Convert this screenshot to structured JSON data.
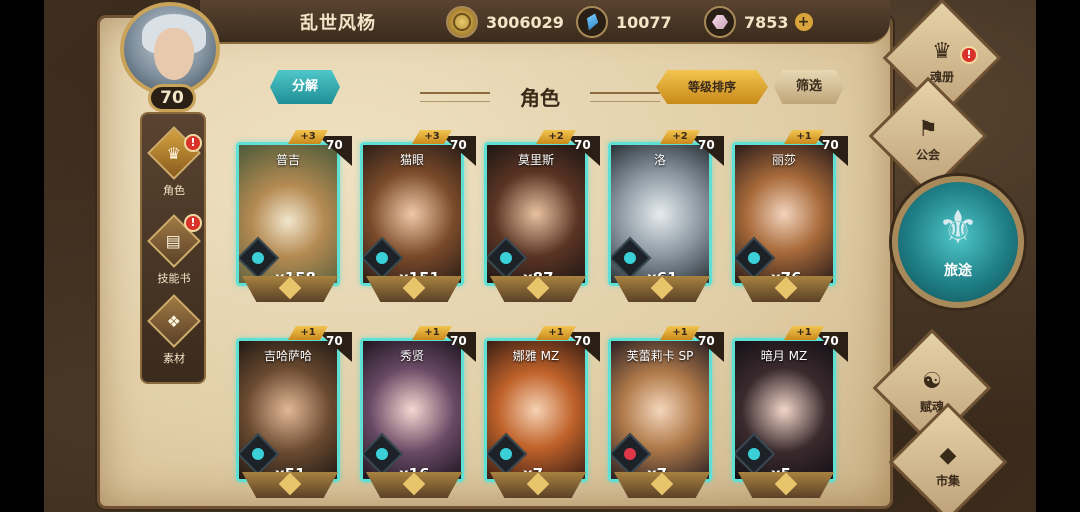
{
  "player": {
    "name": "乱世风杨",
    "level": "70"
  },
  "currencies": [
    {
      "icon": "gold-coin-icon",
      "value": "3006029"
    },
    {
      "icon": "blue-crystal-icon",
      "value": "10077"
    },
    {
      "icon": "pink-crystal-icon",
      "value": "7853"
    }
  ],
  "header": {
    "decompose": "分解",
    "title": "角色",
    "sort": "等级排序",
    "filter": "筛选"
  },
  "sidebar": {
    "items": [
      {
        "label": "角色",
        "active": true,
        "alert": "!"
      },
      {
        "label": "技能书",
        "active": false,
        "alert": "!"
      },
      {
        "label": "素材",
        "active": false,
        "alert": ""
      }
    ]
  },
  "cards": [
    {
      "name": "普吉",
      "level": "70",
      "plus": "+3",
      "count": "x158"
    },
    {
      "name": "猫眼",
      "level": "70",
      "plus": "+3",
      "count": "x151"
    },
    {
      "name": "莫里斯",
      "level": "70",
      "plus": "+2",
      "count": "x87"
    },
    {
      "name": "洛",
      "level": "70",
      "plus": "+2",
      "count": "x61"
    },
    {
      "name": "丽莎",
      "level": "70",
      "plus": "+1",
      "count": "x76"
    },
    {
      "name": "吉哈萨哈",
      "level": "70",
      "plus": "+1",
      "count": "x51"
    },
    {
      "name": "秀贤",
      "level": "70",
      "plus": "+1",
      "count": "x16"
    },
    {
      "name": "娜雅 MZ",
      "level": "70",
      "plus": "+1",
      "count": "x7"
    },
    {
      "name": "芙蕾莉卡 SP",
      "level": "70",
      "plus": "+1",
      "count": "x7"
    },
    {
      "name": "暗月 MZ",
      "level": "70",
      "plus": "+1",
      "count": "x5"
    }
  ],
  "rightnav": {
    "soulbook": "魂册",
    "guild": "公会",
    "journey": "旅途",
    "soul": "赋魂",
    "market": "市集",
    "alert": "!"
  },
  "colors": {
    "accent_teal": "#5fe0d4",
    "accent_gold": "#f2c450",
    "alert_red": "#d8322b"
  }
}
